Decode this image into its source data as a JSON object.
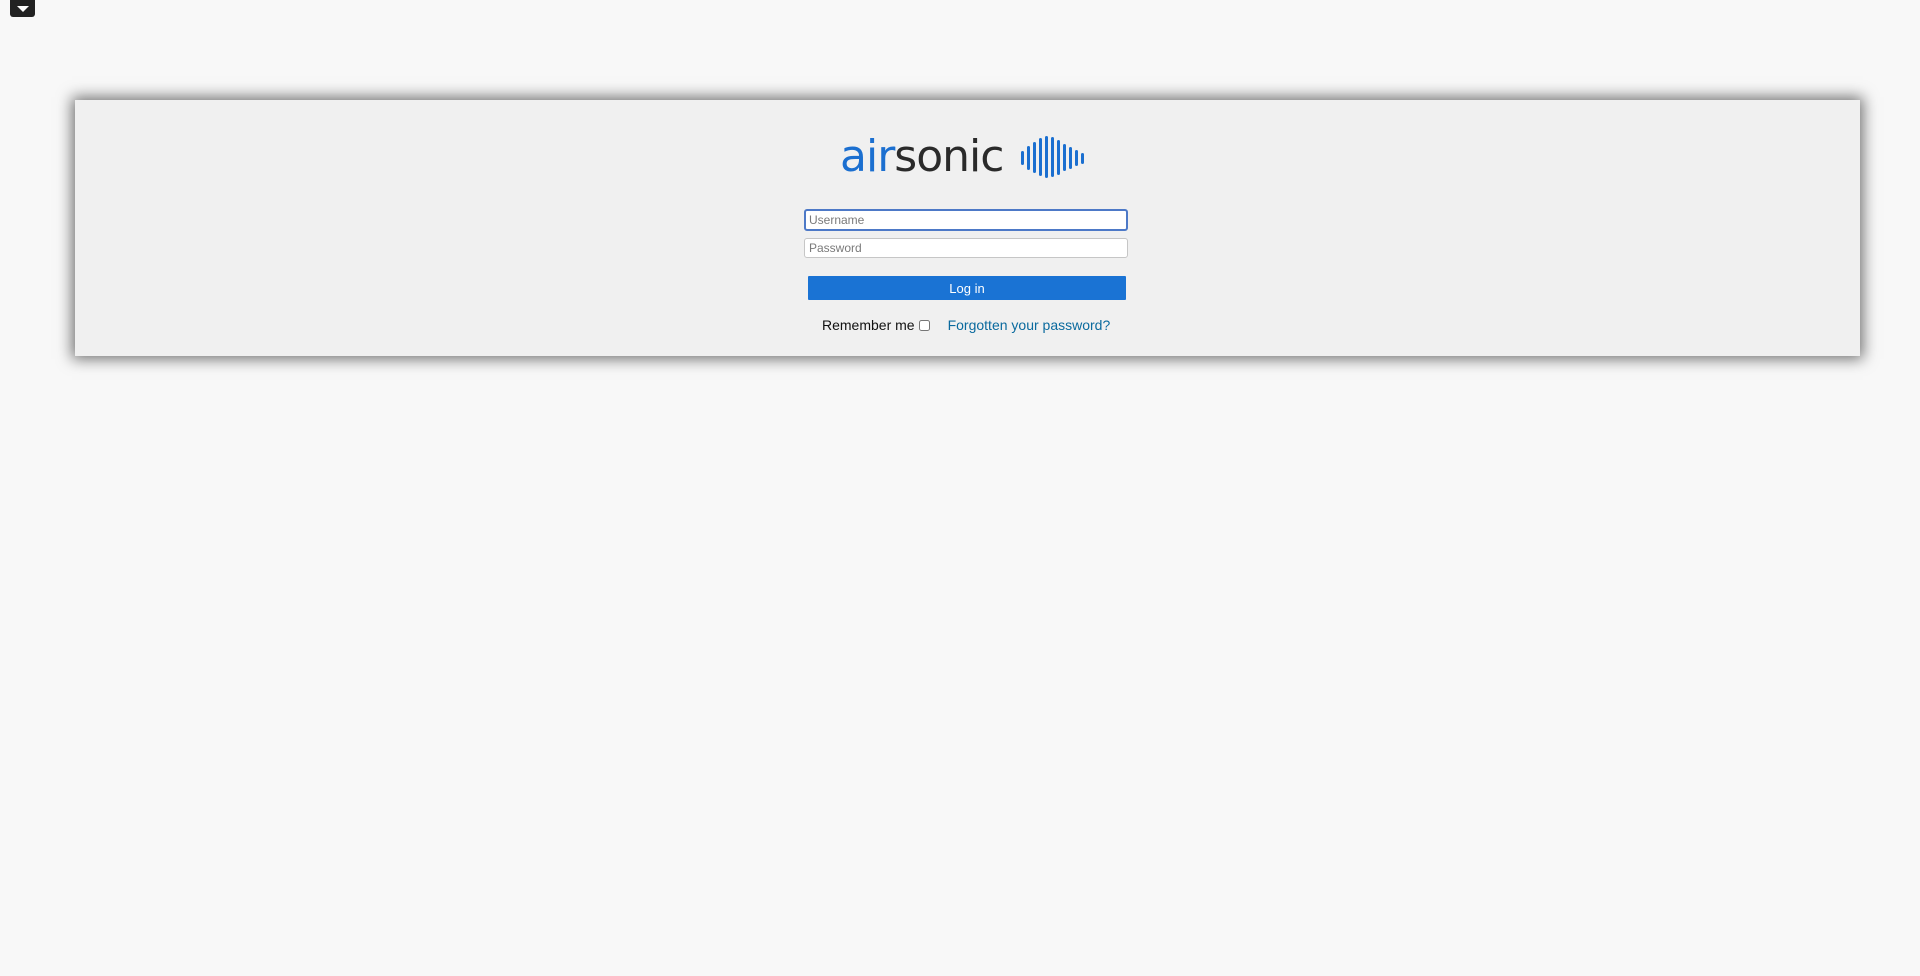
{
  "toolbar": {
    "toggle_icon": "caret-down-icon"
  },
  "logo": {
    "text_part1": "air",
    "text_part2": "sonic",
    "mark_icon": "soundwave-icon",
    "brand_color": "#1b6fd0",
    "text_color": "#2a2a2a"
  },
  "login_form": {
    "username_placeholder": "Username",
    "username_value": "",
    "password_placeholder": "Password",
    "password_value": "",
    "login_button_label": "Log in",
    "remember_label": "Remember me",
    "remember_checked": false,
    "forgot_link_text": "Forgotten your password?",
    "button_color": "#1a73d4",
    "link_color": "#0a6a9e"
  }
}
